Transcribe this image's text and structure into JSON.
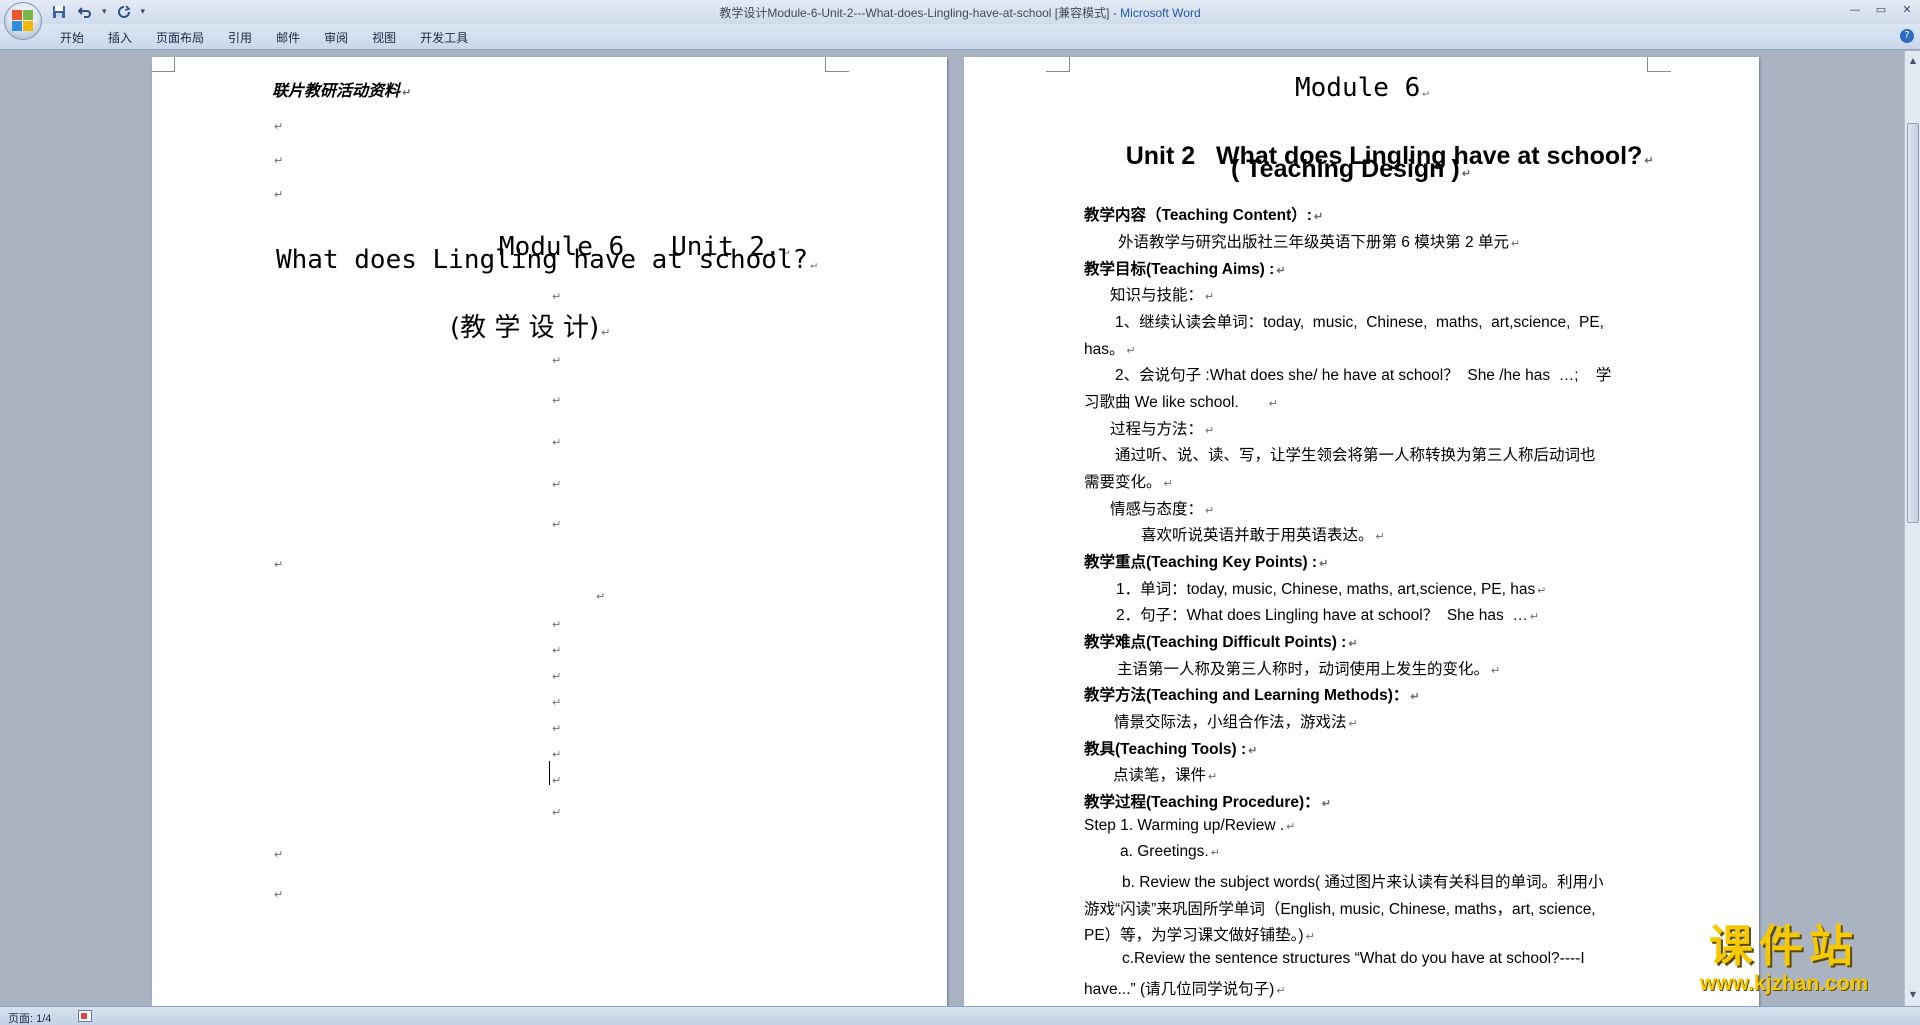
{
  "window": {
    "title": "教学设计Module-6-Unit-2---What-does-Lingling-have-at-school [兼容模式]",
    "app_name": "Microsoft Word"
  },
  "ribbon": {
    "tabs": [
      "开始",
      "插入",
      "页面布局",
      "引用",
      "邮件",
      "审阅",
      "视图",
      "开发工具"
    ]
  },
  "status": {
    "page": "页面: 1/4"
  },
  "pilcrow": "↵",
  "left_page": {
    "header": "联片教研活动资料",
    "title1": "Module 6   Unit 2.",
    "title2": "What does Lingling have at school?",
    "title3": "(教 学 设 计)"
  },
  "right_page": {
    "title1": "Module 6",
    "title2": "Unit 2   What does Lingling have at school?",
    "title3": "( Teaching Design )",
    "paragraphs": [
      "教学内容（Teaching Content）:",
      "外语教学与研究出版社三年级英语下册第 6 模块第 2 单元",
      "教学目标(Teaching Aims) :",
      "知识与技能：",
      "1、继续认读会单词：today,  music,  Chinese,  maths,  art,science,  PE,",
      "has。",
      "2、会说句子 :What does she/ he have at school？  She /he has  …;    学",
      "习歌曲 We like school.",
      "过程与方法：",
      "通过听、说、读、写，让学生领会将第一人称转换为第三人称后动词也",
      "需要变化。",
      "情感与态度：",
      "喜欢听说英语并敢于用英语表达。",
      "教学重点(Teaching Key Points) :",
      "1．单词：today, music, Chinese, maths, art,science, PE, has",
      "2．句子：What does Lingling have at school？  She has  …",
      "教学难点(Teaching Difficult Points) :",
      "主语第一人称及第三人称时，动词使用上发生的变化。",
      "教学方法(Teaching and Learning Methods)：",
      "情景交际法，小组合作法，游戏法",
      "教具(Teaching Tools) :",
      "点读笔，课件",
      "教学过程(Teaching Procedure)：",
      "Step 1. Warming up/Review .",
      "a. Greetings.",
      "b. Review the subject words( 通过图片来认读有关科目的单词。利用小",
      "游戏“闪读”来巩固所学单词（English, music, Chinese, maths，art, science,",
      "PE）等，为学习课文做好铺垫。)",
      "c.Review the sentence structures “What do you have at school?----I",
      "have...” (请几位同学说句子)"
    ]
  },
  "watermark": {
    "title": "课件站",
    "url": "www.kjzhan.com"
  },
  "colors": {
    "app_name": "#1e5aa8",
    "watermark": "#f6c800",
    "workspace": "#a9b3c2"
  },
  "icons": [
    "office-button-icon",
    "save-icon",
    "undo-icon",
    "redo-icon",
    "customize-qat-icon",
    "minimize-icon",
    "maximize-icon",
    "close-icon",
    "help-icon",
    "scroll-up-icon",
    "scroll-down-icon"
  ]
}
